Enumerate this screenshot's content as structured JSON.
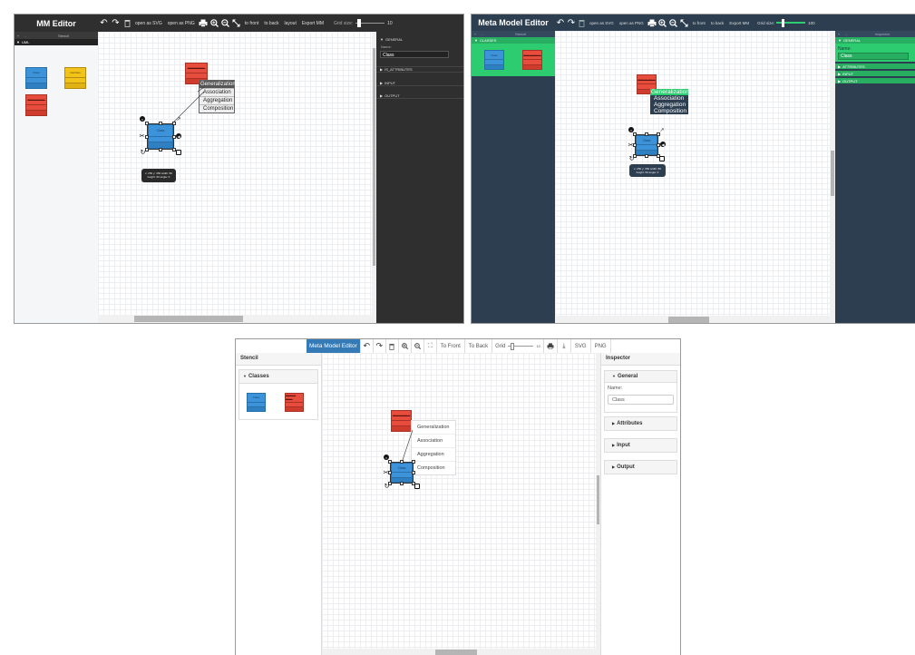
{
  "mockups": [
    {
      "brand": "MM Editor",
      "toolbar": {
        "undo_icon": "undo-icon",
        "redo_icon": "redo-icon",
        "delete_icon": "trash-icon",
        "open_svg": "open as SVG",
        "open_png": "open as PNG",
        "print_icon": "print-icon",
        "zoom_in_icon": "zoom-in-icon",
        "zoom_out_icon": "zoom-out-icon",
        "fit_icon": "fit-icon",
        "to_front": "to front",
        "to_back": "to back",
        "layout": "layout",
        "export": "Export MM",
        "grid_label": "Grid size:",
        "grid_value": "10"
      },
      "stencil": {
        "title": "Stencil",
        "group": "UML"
      },
      "stencil_shapes": {
        "class": "Class",
        "interface": "Interface",
        "abstract": "Abstract Class"
      },
      "canvas": {
        "abstract_label": "Abstract Class",
        "class_label": "Class",
        "menu": [
          "Generalization",
          "Association",
          "Aggregation",
          "Composition"
        ],
        "tooltip_line1": "x: 250 y: 350 width: 80",
        "tooltip_line2": "height: 60 angle: 0"
      },
      "inspector": {
        "general": "GENERAL",
        "name_label": "Name:",
        "name_value": "Class",
        "attributes": "IS_ATTRIBUTES",
        "input": "INPUT",
        "output": "OUTPUT"
      },
      "colors": {
        "toolbar": "#2f2f2f",
        "inspector": "#2f2f2f",
        "canvas": "#ffffff"
      }
    },
    {
      "brand": "Meta Model Editor",
      "toolbar": {
        "open_svg": "open as SVG",
        "open_png": "open as PNG",
        "to_front": "to front",
        "to_back": "to back",
        "export": "Export MM",
        "grid_label": "Grid size:",
        "grid_value": "100"
      },
      "stencil": {
        "title": "Stencil",
        "group": "CLASSES"
      },
      "stencil_shapes": {
        "class": "Class",
        "abstract": "Abstract Class"
      },
      "canvas": {
        "abstract_label": "Abstract Class",
        "class_label": "Class",
        "menu": [
          "Generalization",
          "Association",
          "Aggregation",
          "Composition"
        ],
        "tooltip_line1": "x: 250 y: 350 width: 80",
        "tooltip_line2": "height: 60 angle: 0"
      },
      "inspector": {
        "title": "Inspector",
        "general": "GENERAL",
        "name_label": "Name:",
        "name_value": "Class",
        "attributes": "ATTRIBUTES",
        "input": "INPUT",
        "output": "OUTPUT"
      },
      "colors": {
        "toolbar": "#2c3e50",
        "side": "#2c3e50",
        "accent": "#2ecc71"
      }
    },
    {
      "brand": "Meta Model Editor",
      "toolbar": {
        "to_front": "To Front",
        "to_back": "To Back",
        "grid_label": "Grid",
        "grid_value": "10",
        "svg": "SVG",
        "png": "PNG"
      },
      "stencil": {
        "title": "Stencil",
        "group": "Classes"
      },
      "stencil_shapes": {
        "class": "Class",
        "abstract": "Abstract Class"
      },
      "canvas": {
        "abstract_label": "Abstract Class",
        "class_label": "Class",
        "menu": [
          "Generalization",
          "Association",
          "Aggregation",
          "Composition"
        ]
      },
      "inspector": {
        "title": "Inspector",
        "general": "General",
        "name_label": "Name:",
        "name_value": "Class",
        "attributes": "Attributes",
        "input": "Input",
        "output": "Output"
      },
      "colors": {
        "brand": "#337ab7",
        "panel": "#f5f5f5"
      }
    }
  ]
}
